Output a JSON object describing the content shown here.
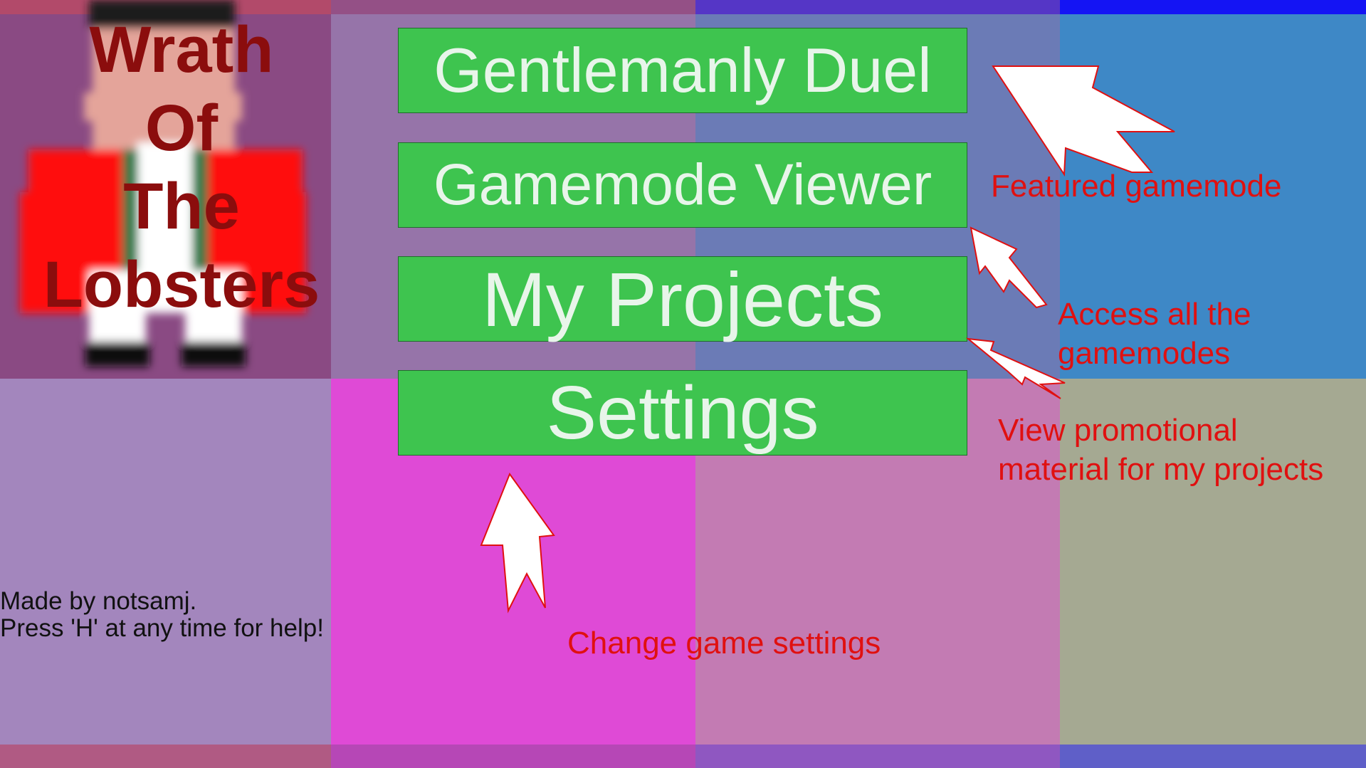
{
  "title": {
    "lines": [
      "Wrath",
      "Of",
      "The",
      "Lobsters"
    ]
  },
  "menu": {
    "buttons": [
      {
        "label": "Gentlemanly Duel"
      },
      {
        "label": "Gamemode Viewer"
      },
      {
        "label": "My Projects"
      },
      {
        "label": "Settings"
      }
    ]
  },
  "annotations": {
    "featured": "Featured gamemode",
    "access_line1": "Access all the",
    "access_line2": "gamemodes",
    "promo_line1": "View promotional",
    "promo_line2": "material for my projects",
    "settings": "Change game settings"
  },
  "credits": {
    "line1": "Made by notsamj.",
    "line2": "Press 'H' at any time for help!"
  },
  "colors": {
    "button_bg": "#3ec44f",
    "button_text": "#e8f5ea",
    "annotation_text": "#e01010",
    "title_text": "#8b0d0d",
    "arrow_fill": "#ffffff",
    "arrow_outline": "#e01010"
  },
  "icons": {
    "arrows": [
      "arrow-featured-icon",
      "arrow-viewer-icon",
      "arrow-projects-icon",
      "arrow-settings-icon"
    ],
    "logo": "lobster-character-icon"
  }
}
